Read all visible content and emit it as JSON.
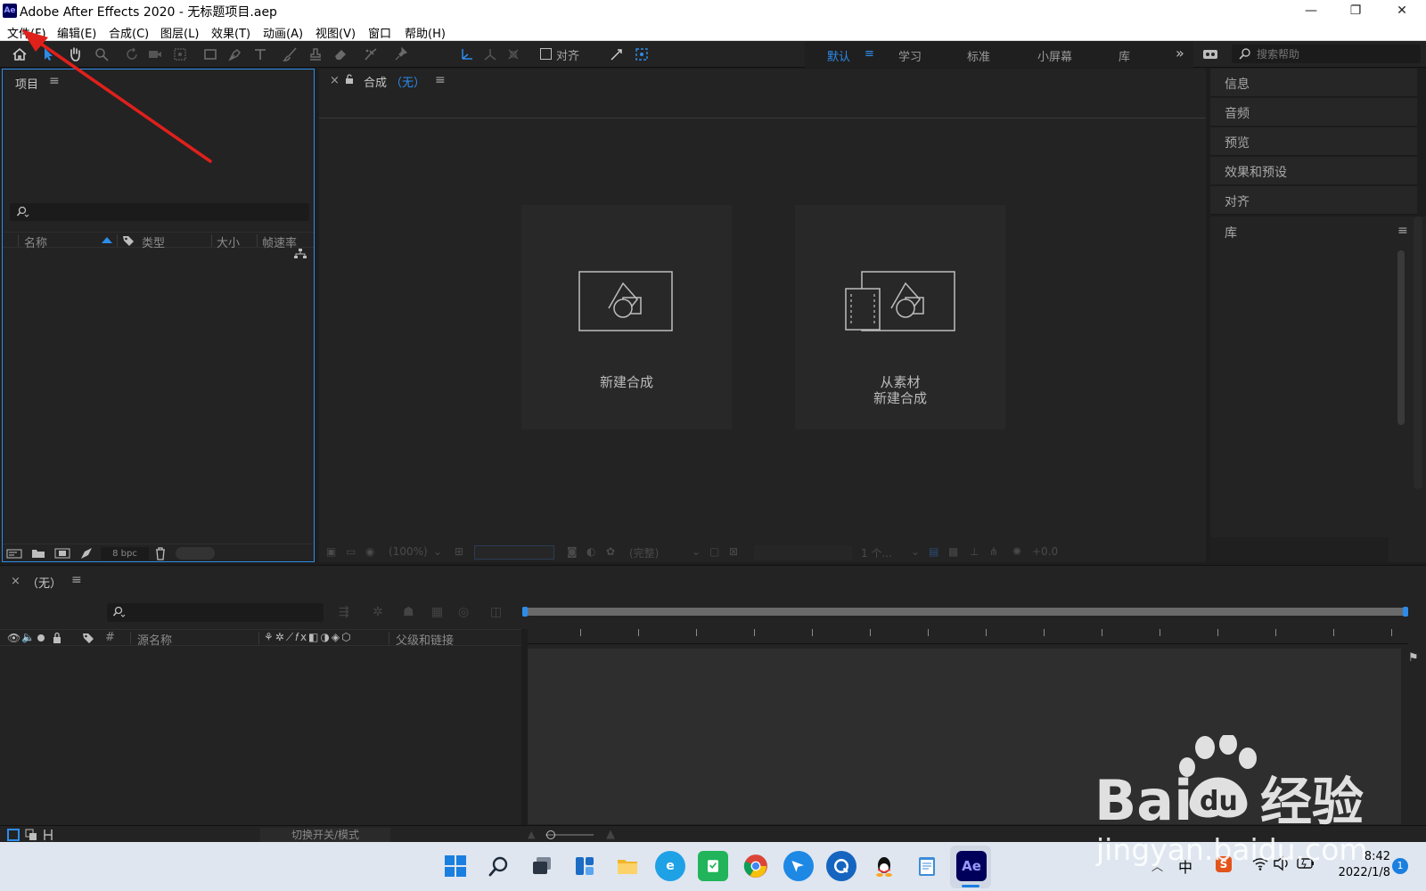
{
  "window": {
    "app_icon_text": "Ae",
    "title": "Adobe After Effects 2020 - 无标题项目.aep",
    "minimize": "—",
    "maximize": "❐",
    "close": "✕"
  },
  "menubar": {
    "items": [
      "文件(F)",
      "编辑(E)",
      "合成(C)",
      "图层(L)",
      "效果(T)",
      "动画(A)",
      "视图(V)",
      "窗口",
      "帮助(H)"
    ]
  },
  "toolbar": {
    "snap_label": "对齐",
    "workspaces": [
      "默认",
      "学习",
      "标准",
      "小屏幕",
      "库"
    ],
    "active_workspace": "默认",
    "overflow": "»",
    "search_placeholder": "搜索帮助",
    "accent_color": "#2d8ceb"
  },
  "project_panel": {
    "title": "项目",
    "menu": "≡",
    "search_placeholder": "",
    "columns": [
      "名称",
      "类型",
      "大小",
      "帧速率"
    ],
    "bpc": "8 bpc"
  },
  "comp_panel": {
    "close": "×",
    "title": "合成",
    "comp_name": "（无）",
    "menu": "≡",
    "card_new_comp": "新建合成",
    "card_from_footage_line1": "从素材",
    "card_from_footage_line2": "新建合成",
    "zoom": "(100%)",
    "resolution": "(完整)",
    "views": "1 个...",
    "exposure": "+0.0"
  },
  "right_panel": {
    "items": [
      "信息",
      "音频",
      "预览",
      "效果和预设",
      "对齐"
    ],
    "library_title": "库",
    "library_menu": "≡"
  },
  "timeline": {
    "close": "×",
    "title": "（无）",
    "menu": "≡",
    "hash": "#",
    "source_name": "源名称",
    "parent_link": "父级和链接",
    "switch_modes": "切换开关/模式"
  },
  "taskbar": {
    "lang": "中",
    "time": "8:42",
    "date": "2022/1/8",
    "notification_count": "1"
  },
  "watermark": {
    "brand": "Bai",
    "brand2": "du",
    "suffix": "经验",
    "url": "jingyan.baidu.com"
  }
}
